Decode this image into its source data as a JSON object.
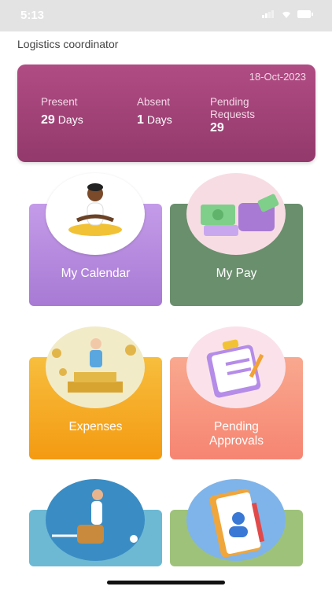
{
  "status": {
    "time": "5:13",
    "icons": "signal-wifi-battery"
  },
  "header": {
    "subtitle": "Logistics coordinator"
  },
  "summary": {
    "date": "18-Oct-2023",
    "present": {
      "label": "Present",
      "value": "29",
      "unit": "Days"
    },
    "absent": {
      "label": "Absent",
      "value": "1",
      "unit": "Days"
    },
    "pending": {
      "label": "Pending Requests",
      "value": "29"
    }
  },
  "tiles": [
    {
      "label": "My Calendar"
    },
    {
      "label": "My Pay"
    },
    {
      "label": "Expenses"
    },
    {
      "label": "Pending Approvals"
    }
  ],
  "colors": {
    "summary_card": "#a3417a",
    "calendar": "#b68ae0",
    "pay": "#6a8f6d",
    "expenses": "#f5a623",
    "approvals": "#f68f7a"
  }
}
